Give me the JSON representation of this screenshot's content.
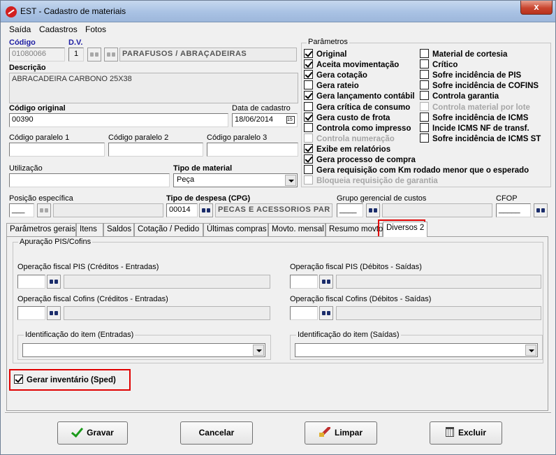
{
  "window": {
    "title": "EST - Cadastro de materiais",
    "close_glyph": "x"
  },
  "menu": [
    "Saída",
    "Cadastros",
    "Fotos"
  ],
  "fields": {
    "codigo_label": "Código",
    "codigo": "01080066",
    "dv_label": "D.V.",
    "dv": "1",
    "grupo": "PARAFUSOS  / ABRAÇADEIRAS",
    "descricao_label": "Descrição",
    "descricao": "ABRACADEIRA CARBONO 25X38",
    "codigo_original_label": "Código original",
    "codigo_original": "00390",
    "data_cadastro_label": "Data de cadastro",
    "data_cadastro": "18/06/2014",
    "paralelo1_label": "Código paralelo 1",
    "paralelo2_label": "Código paralelo 2",
    "paralelo3_label": "Código paralelo 3",
    "utilizacao_label": "Utilização",
    "tipo_material_label": "Tipo de material",
    "tipo_material": "Peça",
    "posicao_label": "Posição específica",
    "posicao": "___",
    "tipo_despesa_label": "Tipo de despesa (CPG)",
    "tipo_despesa_codigo": "00014",
    "tipo_despesa_desc": "PECAS E ACESSORIOS PAR",
    "grupo_gerencial_label": "Grupo gerencial de custos",
    "grupo_gerencial": "____",
    "cfop_label": "CFOP",
    "cfop": "_____"
  },
  "parametros": {
    "title": "Parâmetros",
    "left": [
      {
        "label": "Original",
        "checked": true,
        "disabled": false
      },
      {
        "label": "Aceita movimentação",
        "checked": true,
        "disabled": false
      },
      {
        "label": "Gera cotação",
        "checked": true,
        "disabled": false
      },
      {
        "label": "Gera rateio",
        "checked": false,
        "disabled": false
      },
      {
        "label": "Gera lançamento contábil",
        "checked": true,
        "disabled": false
      },
      {
        "label": "Gera crítica de consumo",
        "checked": false,
        "disabled": false
      },
      {
        "label": "Gera custo de frota",
        "checked": true,
        "disabled": false
      },
      {
        "label": "Controla como impresso",
        "checked": false,
        "disabled": false
      },
      {
        "label": "Controla numeração",
        "checked": false,
        "disabled": true
      },
      {
        "label": "Exibe em relatórios",
        "checked": true,
        "disabled": false
      },
      {
        "label": "Gera processo de compra",
        "checked": true,
        "disabled": false
      },
      {
        "label": "Gera requisição com Km rodado menor que o esperado",
        "checked": false,
        "disabled": false
      },
      {
        "label": "Bloqueia requisição de garantia",
        "checked": false,
        "disabled": true
      }
    ],
    "right": [
      {
        "label": "Material de cortesia",
        "checked": false,
        "disabled": false
      },
      {
        "label": "Crítico",
        "checked": false,
        "disabled": false
      },
      {
        "label": "Sofre incidência de PIS",
        "checked": false,
        "disabled": false
      },
      {
        "label": "Sofre incidência de COFINS",
        "checked": false,
        "disabled": false
      },
      {
        "label": "Controla garantia",
        "checked": false,
        "disabled": false
      },
      {
        "label": "Controla material por lote",
        "checked": false,
        "disabled": true
      },
      {
        "label": "Sofre incidência de ICMS",
        "checked": false,
        "disabled": false
      },
      {
        "label": "Incide ICMS NF de transf.",
        "checked": false,
        "disabled": false
      },
      {
        "label": "Sofre incidência de ICMS ST",
        "checked": false,
        "disabled": false
      }
    ]
  },
  "tabs": [
    {
      "label": "Parâmetros gerais",
      "active": false
    },
    {
      "label": "Itens",
      "active": false
    },
    {
      "label": "Saldos",
      "active": false
    },
    {
      "label": "Cotação / Pedido",
      "active": false
    },
    {
      "label": "Últimas compras",
      "active": false
    },
    {
      "label": "Movto. mensal",
      "active": false
    },
    {
      "label": "Resumo movto.",
      "active": false
    },
    {
      "label": "Diversos 2",
      "active": true
    }
  ],
  "diversos2": {
    "group_title": "Apuração PIS/Cofins",
    "pis_entrada_label": "Operação fiscal PIS (Créditos - Entradas)",
    "pis_saida_label": "Operação fiscal PIS (Débitos - Saídas)",
    "cofins_entrada_label": "Operação fiscal Cofins (Créditos - Entradas)",
    "cofins_saida_label": "Operação fiscal Cofins (Débitos - Saídas)",
    "ident_entrada_label": "Identificação do item (Entradas)",
    "ident_saida_label": "Identificação do item (Saídas)",
    "gerar_inventario": {
      "label": "Gerar inventário (Sped)",
      "checked": true
    }
  },
  "buttons": {
    "gravar": "Gravar",
    "cancelar": "Cancelar",
    "limpar": "Limpar",
    "excluir": "Excluir"
  },
  "colors": {
    "highlight": "#e00000",
    "label_blue": "#1d1da2",
    "title_gradient_top": "#c6d8ee"
  }
}
